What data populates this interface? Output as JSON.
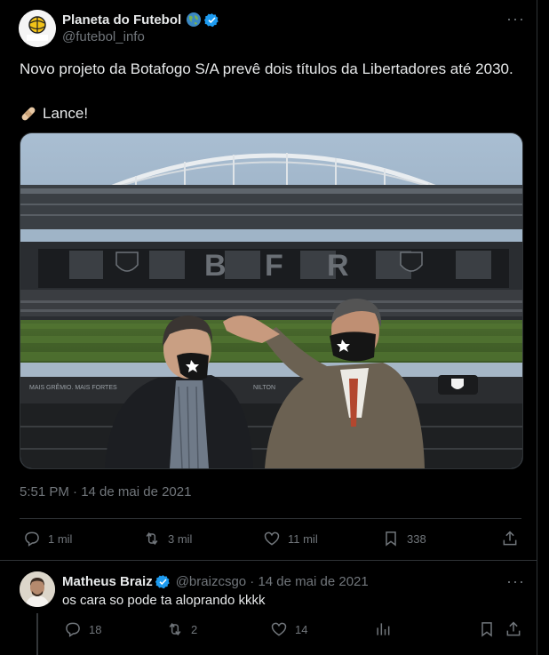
{
  "tweet": {
    "avatar_text": "PLANETA DO FUTEBOL",
    "author_name": "Planeta do Futebol",
    "handle": "@futebol_info",
    "text_line1": "Novo projeto da Botafogo S/A prevê dois títulos da Libertadores até 2030.",
    "text_line2": "Lance!",
    "media": {
      "stadium_letters": [
        "B",
        "F",
        "R"
      ],
      "sign_left": "MAIS GRÊMIO. MAIS FORTES",
      "sign_right": "NILTON"
    },
    "timestamp": "5:51 PM · 14 de mai de 2021",
    "actions": {
      "replies": "1 mil",
      "retweets": "3 mil",
      "likes": "11 mil",
      "bookmarks": "338"
    }
  },
  "reply": {
    "author_name": "Matheus Braiz",
    "handle_date": "@braizcsgo · 14 de mai de 2021",
    "text": "os cara so pode ta aloprando kkkk",
    "actions": {
      "replies": "18",
      "retweets": "2",
      "likes": "14"
    }
  },
  "colors": {
    "background": "#000000",
    "text_primary": "#e7e9ea",
    "text_secondary": "#71767b",
    "verified": "#1d9bf0",
    "divider": "#2f3336"
  }
}
